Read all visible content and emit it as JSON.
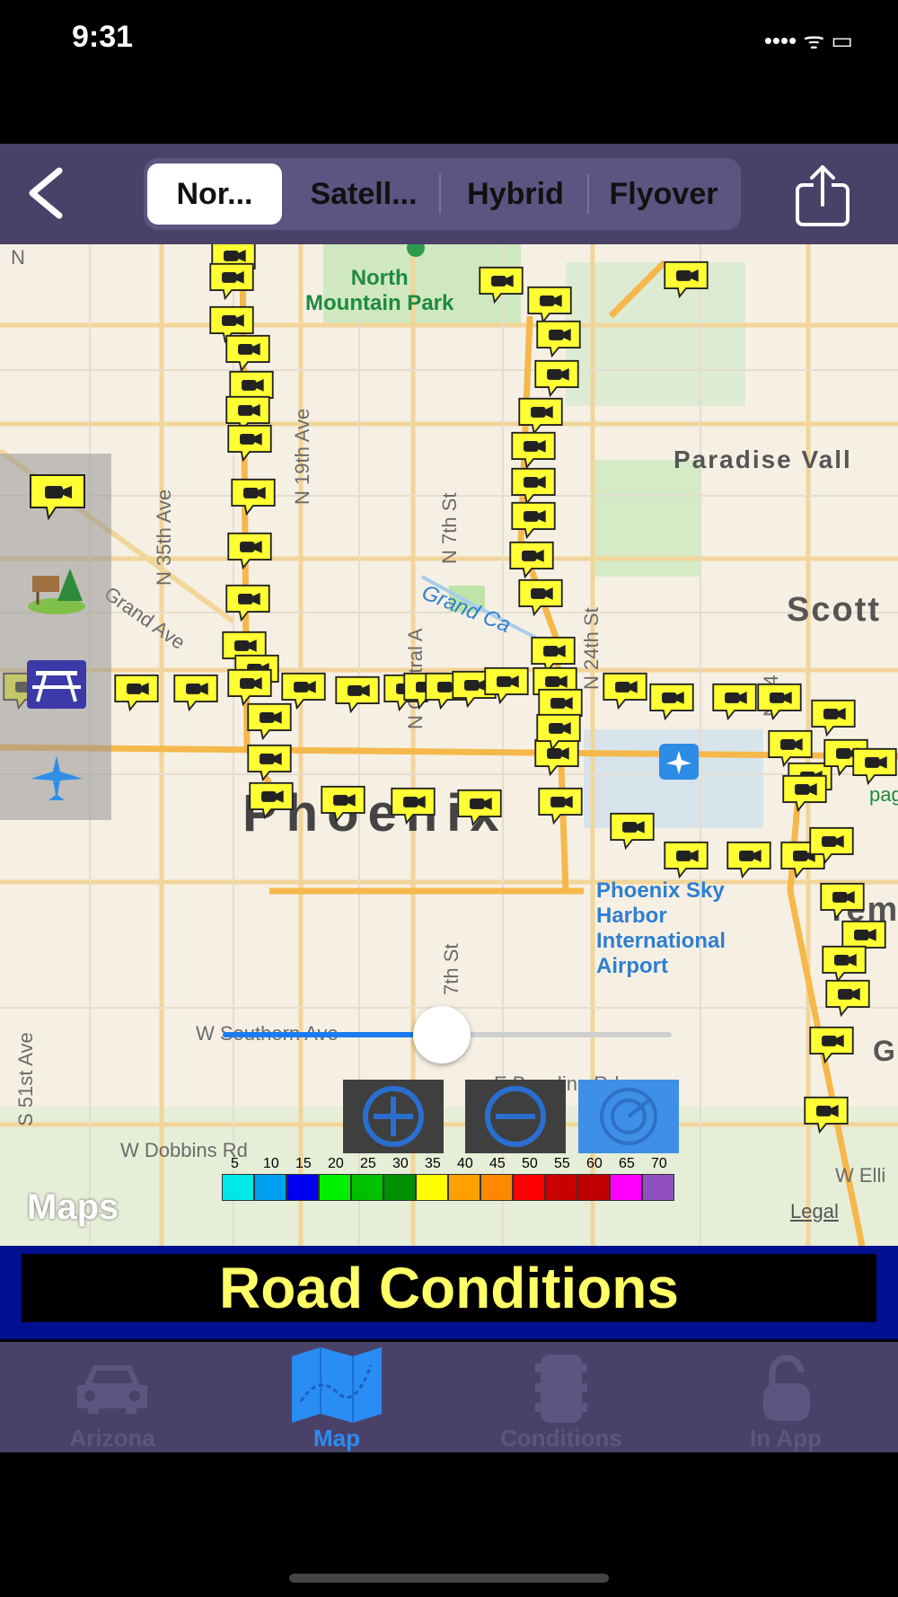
{
  "status": {
    "time": "9:31",
    "icons": "•••• ᯤ ▭"
  },
  "nav": {
    "segments": [
      "Nor...",
      "Satell...",
      "Hybrid",
      "Flyover"
    ],
    "active_segment": "Nor..."
  },
  "map": {
    "labels": {
      "north_mountain_park": "North\nMountain Park",
      "paradise_valley": "Paradise Vall",
      "scottsdale": "Scott",
      "phoenix": "Phoenix",
      "tempe": "Tem",
      "airport": "Phoenix Sky\nHarbor\nInternational\nAirport",
      "grand_ave": "Grand Ave",
      "grand_canal": "Grand Ca",
      "n_35th_ave": "N 35th Ave",
      "n_19th_ave": "N 19th Ave",
      "n_7th_st": "N 7th St",
      "n_central": "N Central A",
      "n_24th_st": "N 24th St",
      "n_44th": "N 44",
      "s_51st_ave": "S 51st Ave",
      "w_southern_ave": "W Southern Ave",
      "e_baseline_rd": "E Baseline Rd",
      "w_dobbins_rd": "W Dobbins Rd",
      "seventh_st_s": "7th St",
      "w_elli": "W Elli",
      "n": "N",
      "pag": "pag",
      "g": "G"
    },
    "attribution": "Maps",
    "legal": "Legal"
  },
  "legend": {
    "ticks": [
      "5",
      "10",
      "15",
      "20",
      "25",
      "30",
      "35",
      "40",
      "45",
      "50",
      "55",
      "60",
      "65",
      "70"
    ],
    "colors": [
      "#00e8e8",
      "#00a0f0",
      "#0000f0",
      "#00f000",
      "#00c000",
      "#009000",
      "#ffff00",
      "#ffa000",
      "#ff8800",
      "#ff0000",
      "#c80000",
      "#c00000",
      "#ff00ff",
      "#9050c0"
    ]
  },
  "icons": {
    "camera": "traffic-camera-icon",
    "rest_area": "rest-area-icon",
    "picnic": "picnic-table-icon",
    "airport": "airport-icon",
    "zoom_in": "zoom-in-icon",
    "zoom_out": "zoom-out-icon",
    "radar": "radar-icon"
  },
  "banner": {
    "title": "Road Conditions"
  },
  "tabs": [
    {
      "label": "Arizona",
      "icon": "car-icon"
    },
    {
      "label": "Map",
      "icon": "map-icon"
    },
    {
      "label": "Conditions",
      "icon": "traffic-light-icon"
    },
    {
      "label": "In App",
      "icon": "unlock-icon"
    }
  ],
  "active_tab": "Map",
  "colors": {
    "accent": "#2a8cf5",
    "bar": "#4a4168",
    "banner_text": "#ffff66",
    "banner_bg": "#001090"
  }
}
